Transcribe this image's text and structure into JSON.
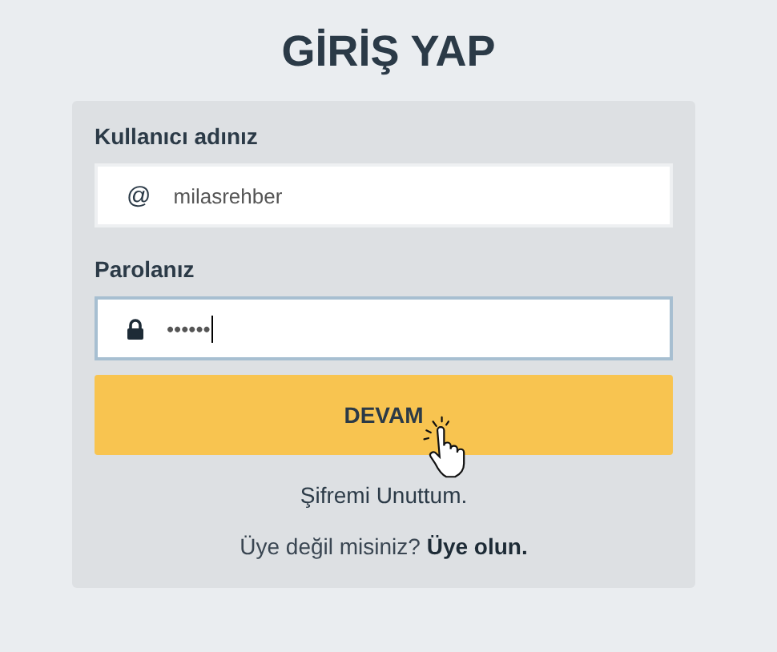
{
  "title": "GİRİŞ YAP",
  "fields": [
    {
      "label": "Kullanıcı adınız",
      "kind": "user",
      "icon": "@",
      "value": "milasrehber",
      "focused": false
    },
    {
      "label": "Parolanız",
      "kind": "password",
      "value": "••••••",
      "focused": true
    }
  ],
  "submit": "DEVAM",
  "forgot": "Şifremi Unuttum.",
  "register": {
    "text": "Üye değil misiniz?",
    "link": "Üye olun."
  }
}
